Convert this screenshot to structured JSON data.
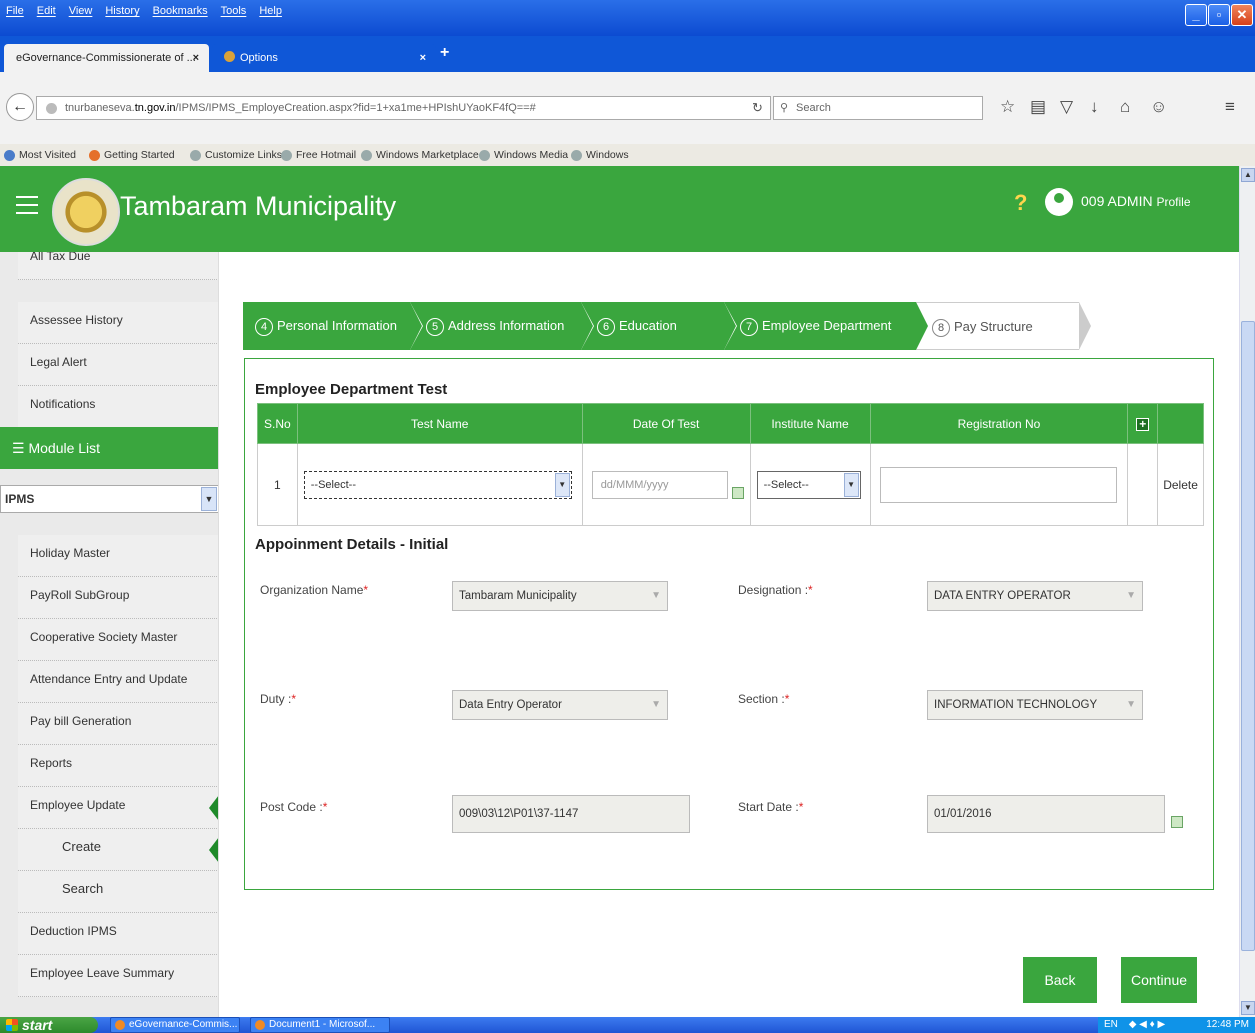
{
  "browser": {
    "menus": [
      "File",
      "Edit",
      "View",
      "History",
      "Bookmarks",
      "Tools",
      "Help"
    ],
    "tabs": [
      {
        "label": "eGovernance-Commissionerate of ..."
      },
      {
        "label": "Options"
      }
    ],
    "url_prefix": "tnurbaneseva.",
    "url_domain": "tn.gov.in",
    "url_path": "/IPMS/IPMS_EmployeCreation.aspx?fid=1+xa1me+HPIshUYaoKF4fQ==#",
    "search_placeholder": "Search",
    "bookmarks": [
      "Most Visited",
      "Getting Started",
      "Customize Links",
      "Free Hotmail",
      "Windows Marketplace",
      "Windows Media",
      "Windows"
    ]
  },
  "header": {
    "title": "Tambaram Municipality",
    "help": "?",
    "profile_name": "009 ADMIN",
    "profile_link": "Profile",
    "brand_color": "#3aa63e"
  },
  "sidebar": {
    "top_items": [
      "All Tax Due",
      "Assessee History",
      "Legal Alert",
      "Notifications"
    ],
    "module_list_label": "Module List",
    "module_selected": "IPMS",
    "items": [
      "Holiday Master",
      "PayRoll SubGroup",
      "Cooperative Society Master",
      "Attendance Entry and Update",
      "Pay bill Generation",
      "Reports",
      "Employee Update"
    ],
    "sub_items": [
      "Create",
      "Search"
    ],
    "bottom_items": [
      "Deduction IPMS",
      "Employee Leave Summary"
    ]
  },
  "steps": [
    {
      "num": "4",
      "label": "Personal Information"
    },
    {
      "num": "5",
      "label": "Address Information"
    },
    {
      "num": "6",
      "label": "Education Details"
    },
    {
      "num": "7",
      "label": "Employee Department Test"
    },
    {
      "num": "8",
      "label": "Pay Structure Details"
    }
  ],
  "dept_test": {
    "title": "Employee Department Test",
    "columns": [
      "S.No",
      "Test Name",
      "Date Of Test",
      "Institute Name",
      "Registration No"
    ],
    "row": {
      "sno": "1",
      "test_name": "--Select--",
      "date_placeholder": "dd/MMM/yyyy",
      "institute": "--Select--",
      "registration": "",
      "delete": "Delete"
    }
  },
  "appointment": {
    "title": "Appoinment Details - Initial",
    "required_mark": "*",
    "fields": {
      "organization_label": "Organization Name",
      "organization_value": "Tambaram Municipality",
      "designation_label": "Designation :",
      "designation_value": "DATA ENTRY OPERATOR",
      "duty_label": "Duty :",
      "duty_value": "Data Entry Operator",
      "section_label": "Section :",
      "section_value": "INFORMATION TECHNOLOGY",
      "postcode_label": "Post Code :",
      "postcode_value": "009\\03\\12\\P01\\37-1147",
      "startdate_label": "Start Date :",
      "startdate_value": "01/01/2016"
    }
  },
  "buttons": {
    "back": "Back",
    "continue": "Continue"
  },
  "taskbar": {
    "start": "start",
    "tasks": [
      "eGovernance-Commis...",
      "Document1 - Microsof..."
    ],
    "lang": "EN",
    "clock": "12:48 PM"
  }
}
